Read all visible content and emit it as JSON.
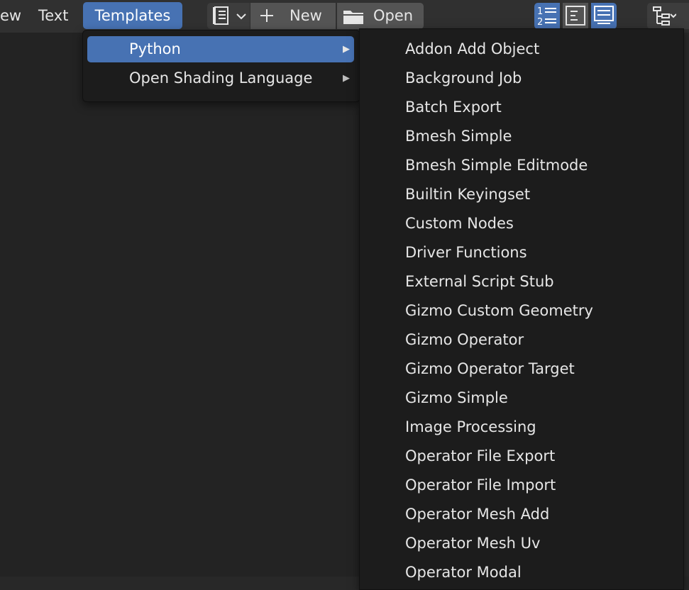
{
  "header": {
    "menus": [
      {
        "label": "ew"
      },
      {
        "label": "Text"
      },
      {
        "label": "Templates",
        "active": true
      }
    ],
    "new_label": "New",
    "open_label": "Open"
  },
  "templates_menu": {
    "items": [
      {
        "label": "Python",
        "highlighted": true,
        "has_submenu": true
      },
      {
        "label": "Open Shading Language",
        "highlighted": false,
        "has_submenu": true
      }
    ]
  },
  "python_menu": {
    "items": [
      "Addon Add Object",
      "Background Job",
      "Batch Export",
      "Bmesh Simple",
      "Bmesh Simple Editmode",
      "Builtin Keyingset",
      "Custom Nodes",
      "Driver Functions",
      "External Script Stub",
      "Gizmo Custom Geometry",
      "Gizmo Operator",
      "Gizmo Operator Target",
      "Gizmo Simple",
      "Image Processing",
      "Operator File Export",
      "Operator File Import",
      "Operator Mesh Add",
      "Operator Mesh Uv",
      "Operator Modal"
    ]
  },
  "colors": {
    "accent": "#4772b3",
    "menu_bg": "#1c1c1c",
    "header_bg": "#303030",
    "text": "#e6e6e6"
  },
  "icons": [
    "text-datablock-icon",
    "chevron-down-icon",
    "plus-icon",
    "folder-icon",
    "line-numbers-icon",
    "word-wrap-icon",
    "syntax-highlight-icon",
    "outliner-icon"
  ]
}
